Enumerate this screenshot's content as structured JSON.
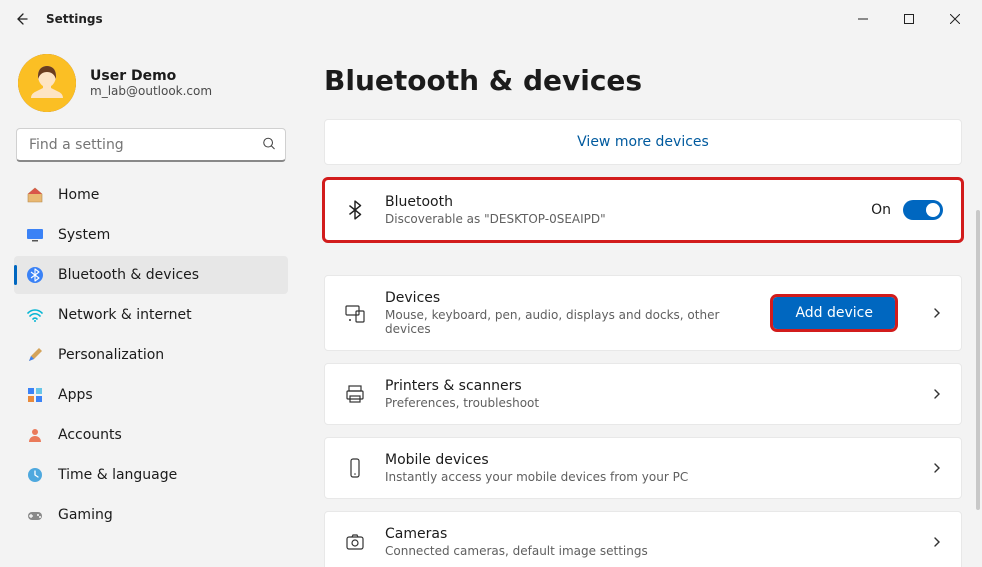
{
  "window": {
    "title": "Settings"
  },
  "profile": {
    "name": "User Demo",
    "email": "m_lab@outlook.com"
  },
  "search": {
    "placeholder": "Find a setting"
  },
  "nav": {
    "items": [
      {
        "label": "Home"
      },
      {
        "label": "System"
      },
      {
        "label": "Bluetooth & devices"
      },
      {
        "label": "Network & internet"
      },
      {
        "label": "Personalization"
      },
      {
        "label": "Apps"
      },
      {
        "label": "Accounts"
      },
      {
        "label": "Time & language"
      },
      {
        "label": "Gaming"
      }
    ]
  },
  "page": {
    "title": "Bluetooth & devices",
    "view_more": "View more devices",
    "bluetooth": {
      "title": "Bluetooth",
      "sub": "Discoverable as \"DESKTOP-0SEAIPD\"",
      "state": "On"
    },
    "devices": {
      "title": "Devices",
      "sub": "Mouse, keyboard, pen, audio, displays and docks, other devices",
      "button": "Add device"
    },
    "printers": {
      "title": "Printers & scanners",
      "sub": "Preferences, troubleshoot"
    },
    "mobile": {
      "title": "Mobile devices",
      "sub": "Instantly access your mobile devices from your PC"
    },
    "cameras": {
      "title": "Cameras",
      "sub": "Connected cameras, default image settings"
    }
  }
}
